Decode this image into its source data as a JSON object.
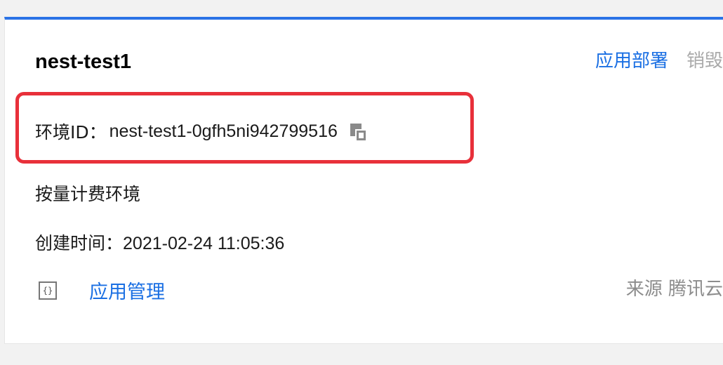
{
  "environment": {
    "name": "nest-test1",
    "id_label": "环境ID：",
    "id_value": "nest-test1-0gfh5ni942799516",
    "billing_type": "按量计费环境",
    "created_label": "创建时间：",
    "created_value": "2021-02-24 11:05:36"
  },
  "actions": {
    "deploy_label": "应用部署",
    "destroy_label": "销毁"
  },
  "footer": {
    "app_icon_glyph": "{}",
    "app_management_label": "应用管理",
    "source_text": "来源 腾讯云"
  },
  "colors": {
    "accent_blue": "#2b73e6",
    "link_blue": "#1a6fe3",
    "highlight_red": "#e8303a",
    "muted_gray": "#aaaaaa"
  },
  "icons": {
    "copy": "copy-icon",
    "app": "app-code-icon"
  }
}
